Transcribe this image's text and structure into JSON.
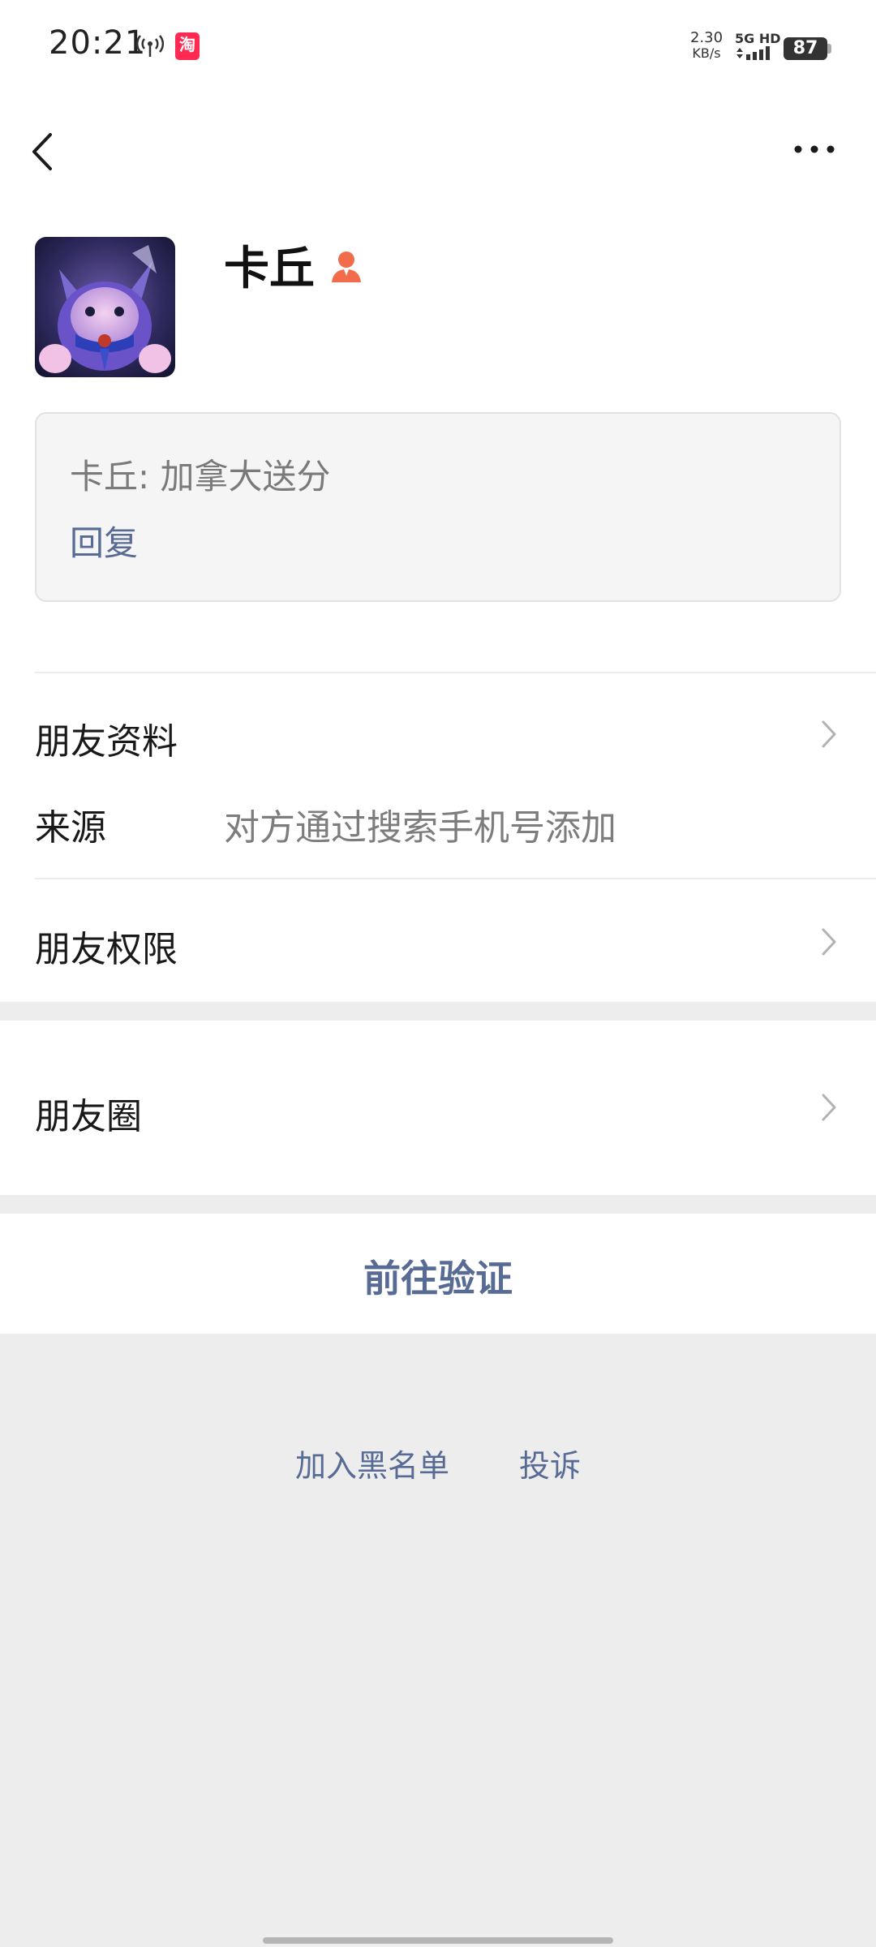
{
  "status_bar": {
    "time": "20:21",
    "taobao_glyph": "淘",
    "net_speed": "2.30",
    "net_speed_unit": "KB/s",
    "signal_label": "5G HD",
    "battery": "87"
  },
  "profile": {
    "name": "卡丘"
  },
  "message": {
    "text": "卡丘: 加拿大送分",
    "reply_label": "回复"
  },
  "rows": {
    "friend_info": "朋友资料",
    "source_label": "来源",
    "source_value": "对方通过搜索手机号添加",
    "permissions": "朋友权限",
    "moments": "朋友圈"
  },
  "actions": {
    "verify": "前往验证",
    "blacklist": "加入黑名单",
    "complain": "投诉"
  },
  "colors": {
    "link": "#576b95",
    "background": "#ededed",
    "person_icon": "#f26b4a"
  },
  "icons": [
    "back-icon",
    "more-icon",
    "person-icon",
    "chevron-right-icon",
    "hotspot-icon",
    "taobao-icon"
  ]
}
